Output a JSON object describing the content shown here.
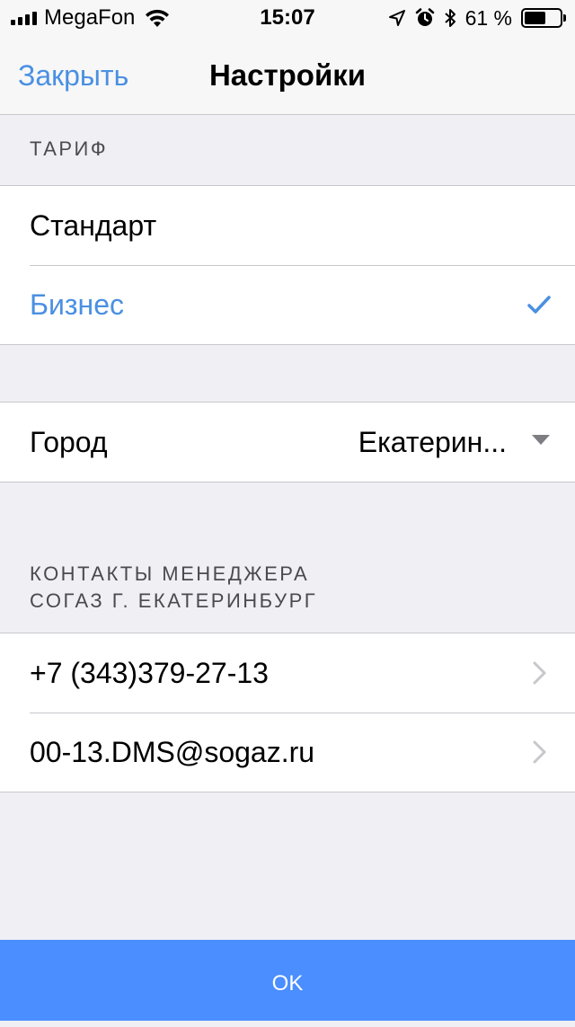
{
  "status_bar": {
    "carrier": "MegaFon",
    "time": "15:07",
    "battery_text": "61 %",
    "battery_level": 0.61,
    "icons": [
      "signal-icon",
      "wifi-icon",
      "location-icon",
      "alarm-icon",
      "bluetooth-icon",
      "battery-icon"
    ]
  },
  "nav": {
    "close_label": "Закрыть",
    "title": "Настройки"
  },
  "tariff": {
    "header": "ТАРИФ",
    "options": [
      {
        "label": "Стандарт",
        "selected": false
      },
      {
        "label": "Бизнес",
        "selected": true
      }
    ]
  },
  "city": {
    "label": "Город",
    "value": "Екатерин..."
  },
  "contacts": {
    "header_line1": "КОНТАКТЫ МЕНЕДЖЕРА",
    "header_line2": "СОГАЗ Г. ЕКАТЕРИНБУРГ",
    "items": [
      {
        "label": "+7 (343)379-27-13"
      },
      {
        "label": "00-13.DMS@sogaz.ru"
      }
    ]
  },
  "ok_button": {
    "label": "OK"
  },
  "colors": {
    "accent": "#4a90e2",
    "ok_background": "#4a8eff",
    "background": "#efeff4"
  }
}
